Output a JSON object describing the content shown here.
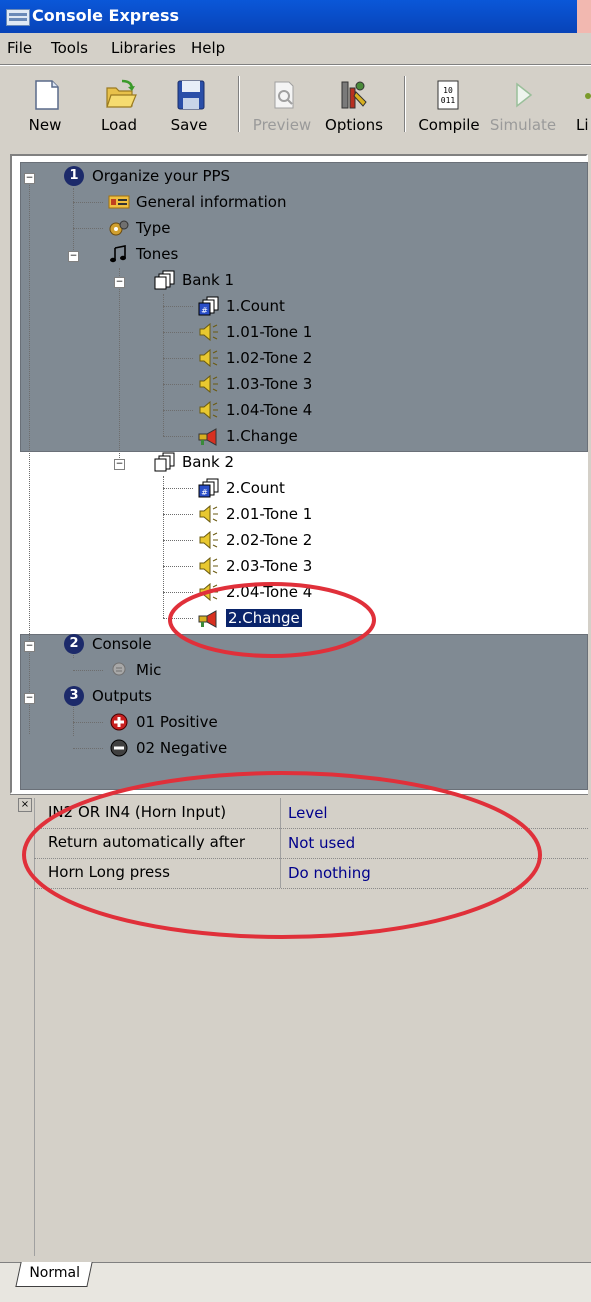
{
  "window": {
    "title": "Console Express",
    "accent": "#0a57d8"
  },
  "menu": [
    "File",
    "Tools",
    "Libraries",
    "Help"
  ],
  "toolbar": [
    {
      "label": "New",
      "icon": "new-file-icon",
      "enabled": true
    },
    {
      "label": "Load",
      "icon": "open-folder-icon",
      "enabled": true
    },
    {
      "label": "Save",
      "icon": "floppy-disk-icon",
      "enabled": true
    },
    {
      "label": "Preview",
      "icon": "preview-icon",
      "enabled": false
    },
    {
      "label": "Options",
      "icon": "tools-icon",
      "enabled": true
    },
    {
      "label": "Compile",
      "icon": "binary-icon",
      "enabled": true
    },
    {
      "label": "Simulate",
      "icon": "play-icon",
      "enabled": false
    },
    {
      "label": "Li",
      "icon": "library-icon",
      "enabled": true
    }
  ],
  "tree": {
    "organize": "Organize your PPS",
    "general": "General information",
    "type": "Type",
    "tones": "Tones",
    "bank1": "Bank 1",
    "b1_count": "1.Count",
    "b1_t1": "1.01-Tone 1",
    "b1_t2": "1.02-Tone 2",
    "b1_t3": "1.03-Tone 3",
    "b1_t4": "1.04-Tone 4",
    "b1_change": "1.Change",
    "bank2": "Bank 2",
    "b2_count": "2.Count",
    "b2_t1": "2.01-Tone 1",
    "b2_t2": "2.02-Tone 2",
    "b2_t3": "2.03-Tone 3",
    "b2_t4": "2.04-Tone 4",
    "b2_change": "2.Change",
    "console": "Console",
    "mic": "Mic",
    "outputs": "Outputs",
    "positive": "01 Positive",
    "negative": "02 Negative",
    "num1": "1",
    "num2": "2",
    "num3": "3"
  },
  "properties": [
    {
      "key": "IN2 OR IN4 (Horn Input)",
      "value": "Level"
    },
    {
      "key": "Return automatically after",
      "value": "Not used"
    },
    {
      "key": "Horn Long press",
      "value": "Do nothing"
    }
  ],
  "tabs": {
    "normal": "Normal"
  },
  "annotation_color": "#e0303a"
}
